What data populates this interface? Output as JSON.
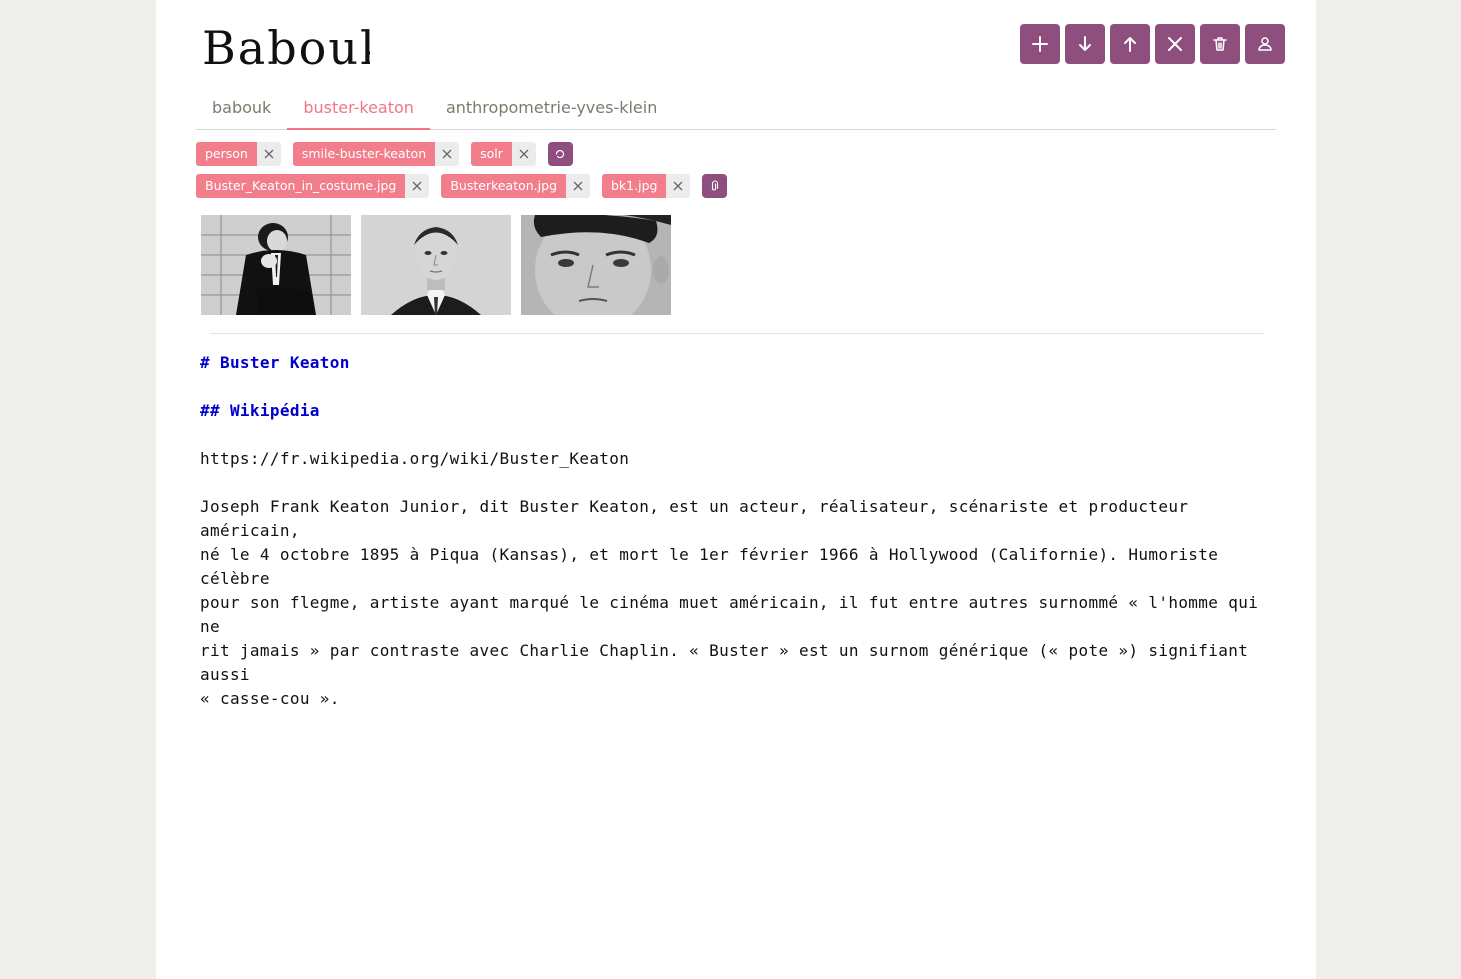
{
  "app": {
    "logo_text": "Babouk"
  },
  "toolbar": {
    "buttons": [
      {
        "name": "add-button",
        "icon": "plus-icon"
      },
      {
        "name": "download-button",
        "icon": "arrow-down-icon"
      },
      {
        "name": "upload-button",
        "icon": "arrow-up-icon"
      },
      {
        "name": "close-button",
        "icon": "close-icon"
      },
      {
        "name": "delete-button",
        "icon": "trash-icon"
      },
      {
        "name": "user-button",
        "icon": "user-icon"
      }
    ]
  },
  "tabs": [
    {
      "label": "babouk",
      "active": false
    },
    {
      "label": "buster-keaton",
      "active": true
    },
    {
      "label": "anthropometrie-yves-klein",
      "active": false
    }
  ],
  "tags": [
    {
      "label": "person"
    },
    {
      "label": "smile-buster-keaton"
    },
    {
      "label": "solr"
    }
  ],
  "tags_action_icon": "refresh-icon",
  "attachments": [
    {
      "label": "Buster_Keaton_in_costume.jpg"
    },
    {
      "label": "Busterkeaton.jpg"
    },
    {
      "label": "bk1.jpg"
    }
  ],
  "attachments_action_icon": "paperclip-icon",
  "images": [
    {
      "name": "thumbnail-buster-keaton-costume"
    },
    {
      "name": "thumbnail-busterkeaton"
    },
    {
      "name": "thumbnail-bk1"
    }
  ],
  "content": {
    "h1": "# Buster Keaton",
    "h2": "## Wikipédia",
    "url": "https://fr.wikipedia.org/wiki/Buster_Keaton",
    "paragraph_lines": [
      "Joseph Frank Keaton Junior, dit Buster Keaton, est un acteur, réalisateur, scénariste et producteur américain,",
      "né le 4 octobre 1895 à Piqua (Kansas), et mort le 1er février 1966 à Hollywood (Californie). Humoriste célèbre",
      "pour son flegme, artiste ayant marqué le cinéma muet américain, il fut entre autres surnommé « l'homme qui ne",
      "rit jamais » par contraste avec Charlie Chaplin. « Buster » est un surnom générique (« pote ») signifiant aussi",
      "« casse-cou »."
    ]
  },
  "colors": {
    "accent": "#8e4f7e",
    "tag": "#f37e8b",
    "active_tab": "#f07585",
    "heading": "#0000cc"
  }
}
